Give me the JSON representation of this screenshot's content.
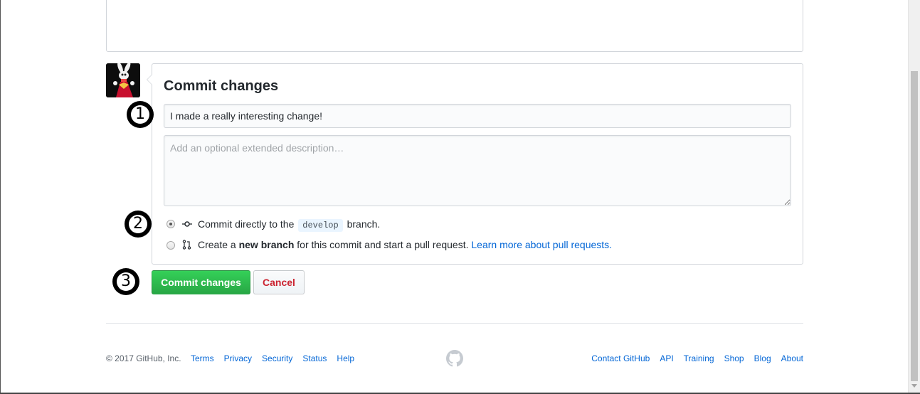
{
  "commit_form": {
    "title": "Commit changes",
    "summary_value": "I made a really interesting change!",
    "description_placeholder": "Add an optional extended description…",
    "options": {
      "direct": {
        "prefix": "Commit directly to the",
        "branch": "develop",
        "suffix": "branch.",
        "selected": true
      },
      "new_branch": {
        "prefix": "Create a",
        "bold": "new branch",
        "suffix": "for this commit and start a pull request.",
        "link": "Learn more about pull requests.",
        "selected": false
      }
    },
    "commit_button": "Commit changes",
    "cancel_button": "Cancel"
  },
  "steps": {
    "one": "1",
    "two": "2",
    "three": "3"
  },
  "footer": {
    "copyright": "© 2017 GitHub, Inc.",
    "left_links": [
      "Terms",
      "Privacy",
      "Security",
      "Status",
      "Help"
    ],
    "right_links": [
      "Contact GitHub",
      "API",
      "Training",
      "Shop",
      "Blog",
      "About"
    ]
  },
  "colors": {
    "primary_button": "#28a745",
    "cancel_text": "#cb2431",
    "link": "#0366d6",
    "branch_code_bg": "#eaf5ff"
  },
  "icons": {
    "commit": "git-commit-icon",
    "pull_request": "git-pull-request-icon",
    "footer_logo": "github-mark-icon"
  }
}
